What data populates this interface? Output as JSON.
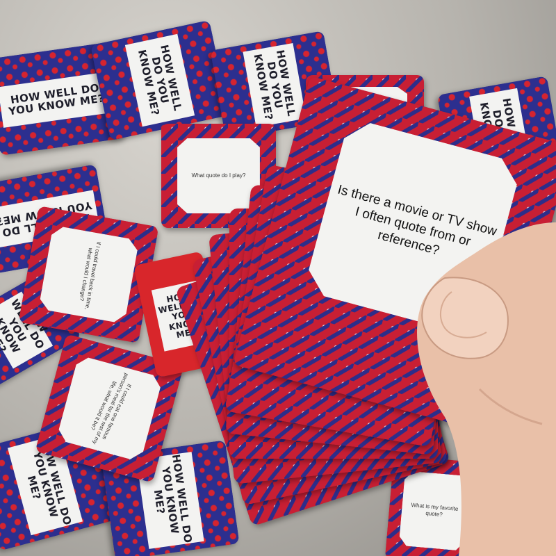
{
  "game": {
    "title_line1": "HOW WELL",
    "title_line2": "DO YOU",
    "title_line3": "KNOW ME?",
    "title_text": "HOW WELL DO YOU KNOW ME?"
  },
  "held_card": {
    "question": "Is there a movie or TV show I often quote from or reference?"
  },
  "scattered_questions": {
    "q1": "What quote do I play?",
    "q2": "If I could travel back in time, what would I change?",
    "q3": "If I could eat one famous person's meal for the rest of my life, what would it be?",
    "q4": "What is my favorite quote?"
  },
  "colors": {
    "card_blue": "#2c2f8f",
    "card_red": "#c81f34",
    "panel_white": "#f3f3f1"
  }
}
